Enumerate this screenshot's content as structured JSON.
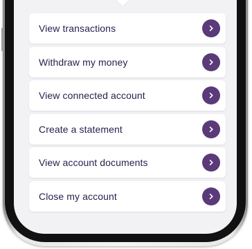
{
  "menu": {
    "items": [
      {
        "label": "View transactions",
        "icon": "chevron-right-icon"
      },
      {
        "label": "Withdraw my money",
        "icon": "chevron-right-icon"
      },
      {
        "label": "View connected account",
        "icon": "chevron-right-icon"
      },
      {
        "label": "Create a statement",
        "icon": "chevron-right-icon"
      },
      {
        "label": "View account documents",
        "icon": "chevron-right-icon"
      },
      {
        "label": "Close my account",
        "icon": "chevron-right-icon"
      }
    ]
  },
  "colors": {
    "accent": "#5a3a78",
    "text": "#2a1d4a",
    "screen_background": "#f2f2f4",
    "card_background": "#ffffff"
  }
}
